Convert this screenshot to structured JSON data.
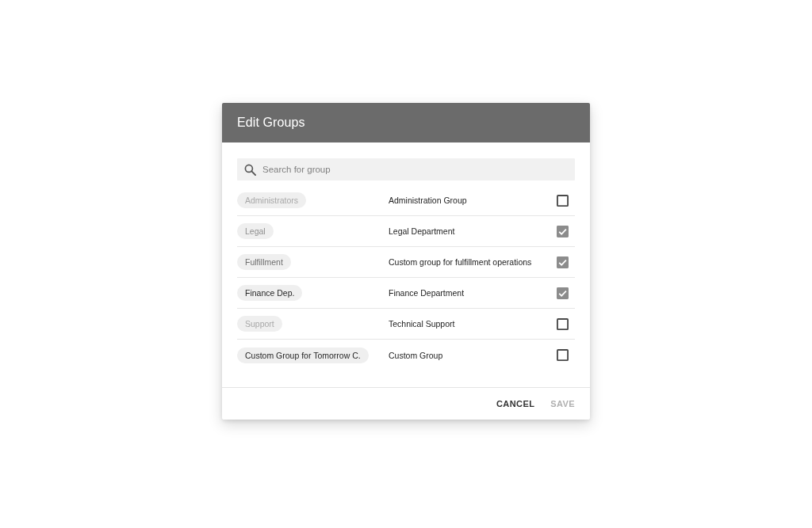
{
  "dialog": {
    "title": "Edit Groups",
    "search": {
      "placeholder": "Search for group"
    },
    "groups": [
      {
        "chip": "Administrators",
        "color": "#a8a8a8",
        "description": "Administration Group",
        "checked": false
      },
      {
        "chip": "Legal",
        "color": "#8e8e8e",
        "description": "Legal Department",
        "checked": true
      },
      {
        "chip": "Fulfillment",
        "color": "#6e6e6e",
        "description": "Custom group for fulfillment operations",
        "checked": true
      },
      {
        "chip": "Finance Dep.",
        "color": "#262626",
        "description": "Finance Department",
        "checked": true
      },
      {
        "chip": "Support",
        "color": "#a8a8a8",
        "description": "Technical Support",
        "checked": false
      },
      {
        "chip": "Custom Group for Tomorrow C.",
        "color": "#262626",
        "description": "Custom Group",
        "checked": false
      }
    ],
    "buttons": [
      {
        "label": "CANCEL",
        "disabled": false
      },
      {
        "label": "SAVE",
        "disabled": true
      }
    ]
  }
}
